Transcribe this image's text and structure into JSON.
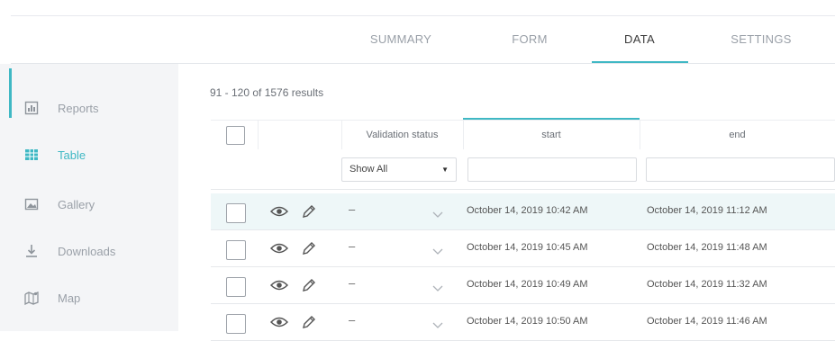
{
  "tabs": [
    {
      "label": "SUMMARY",
      "active": false
    },
    {
      "label": "FORM",
      "active": false
    },
    {
      "label": "DATA",
      "active": true
    },
    {
      "label": "SETTINGS",
      "active": false
    }
  ],
  "sidebar": {
    "items": [
      {
        "label": "Reports",
        "icon": "reports-icon",
        "active": false
      },
      {
        "label": "Table",
        "icon": "table-icon",
        "active": true
      },
      {
        "label": "Gallery",
        "icon": "gallery-icon",
        "active": false
      },
      {
        "label": "Downloads",
        "icon": "downloads-icon",
        "active": false
      },
      {
        "label": "Map",
        "icon": "map-icon",
        "active": false
      }
    ]
  },
  "table": {
    "results_text": "91 - 120 of 1576 results",
    "columns": [
      "Validation status",
      "start",
      "end"
    ],
    "filter": {
      "validation_selected": "Show All"
    },
    "rows": [
      {
        "validation": "–",
        "start": "October 14, 2019 10:42 AM",
        "end": "October 14, 2019 11:12 AM",
        "highlighted": true
      },
      {
        "validation": "–",
        "start": "October 14, 2019 10:45 AM",
        "end": "October 14, 2019 11:48 AM",
        "highlighted": false
      },
      {
        "validation": "–",
        "start": "October 14, 2019 10:49 AM",
        "end": "October 14, 2019 11:32 AM",
        "highlighted": false
      },
      {
        "validation": "–",
        "start": "October 14, 2019 10:50 AM",
        "end": "October 14, 2019 11:46 AM",
        "highlighted": false
      }
    ]
  },
  "colors": {
    "accent": "#3fb8c4",
    "sidebar_bg": "#f4f5f7",
    "muted_text": "#9aa0a8",
    "selected_row_bg": "#eef7f8"
  }
}
